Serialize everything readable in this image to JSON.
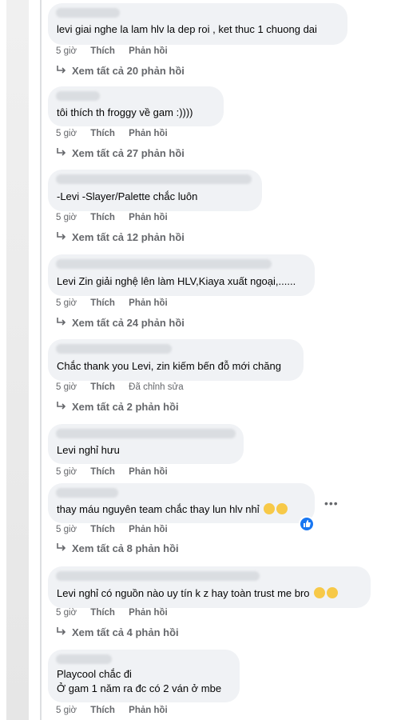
{
  "comments": [
    {
      "text": "levi giai nghe la lam hlv la dep roi , ket thuc 1 chuong dai",
      "time": "5 giờ",
      "like": "Thích",
      "reply": "Phản hồi",
      "view": "Xem tất cả 20 phản hồi"
    },
    {
      "text": "tôi thích th froggy về gam    :))))",
      "time": "5 giờ",
      "like": "Thích",
      "reply": "Phản hồi",
      "view": "Xem tất cả 27 phản hồi"
    },
    {
      "text": "-Levi -Slayer/Palette chắc luôn",
      "time": "5 giờ",
      "like": "Thích",
      "reply": "Phản hồi",
      "view": "Xem tất cả 12 phản hồi"
    },
    {
      "text": "Levi Zin giải nghệ lên làm HLV,Kiaya xuất ngoại,......",
      "time": "5 giờ",
      "like": "Thích",
      "reply": "Phản hồi",
      "view": "Xem tất cả 24 phản hồi"
    },
    {
      "text": "Chắc thank you Levi, zin kiếm bến đỗ mới chăng",
      "time": "5 giờ",
      "like": "Thích",
      "reply": "Đã chỉnh sửa",
      "view": "Xem tất cả 2 phản hồi"
    },
    {
      "text": "Levi nghỉ hưu",
      "time": "5 giờ",
      "like": "Thích",
      "reply": "Phản hồi",
      "view": ""
    },
    {
      "text": "thay máu nguyên team chắc thay lun hlv nhỉ",
      "time": "5 giờ",
      "like": "Thích",
      "reply": "Phản hồi",
      "view": "Xem tất cả 8 phản hồi"
    },
    {
      "text": "Levi nghỉ có nguồn nào uy tín k z hay toàn trust me bro",
      "time": "5 giờ",
      "like": "Thích",
      "reply": "Phản hồi",
      "view": "Xem tất cả 4 phản hồi"
    },
    {
      "text": "Playcool chắc đi",
      "text2": "Ở gam 1 năm ra đc có 2 ván ở mbe",
      "time": "5 giờ",
      "like": "Thích",
      "reply": "Phản hồi",
      "view": ""
    }
  ],
  "more_label": "•••",
  "icons": {
    "reply_arrow": "reply-arrow-icon",
    "emoji": "laughing-emoji-icon",
    "like": "like-reaction-icon"
  }
}
